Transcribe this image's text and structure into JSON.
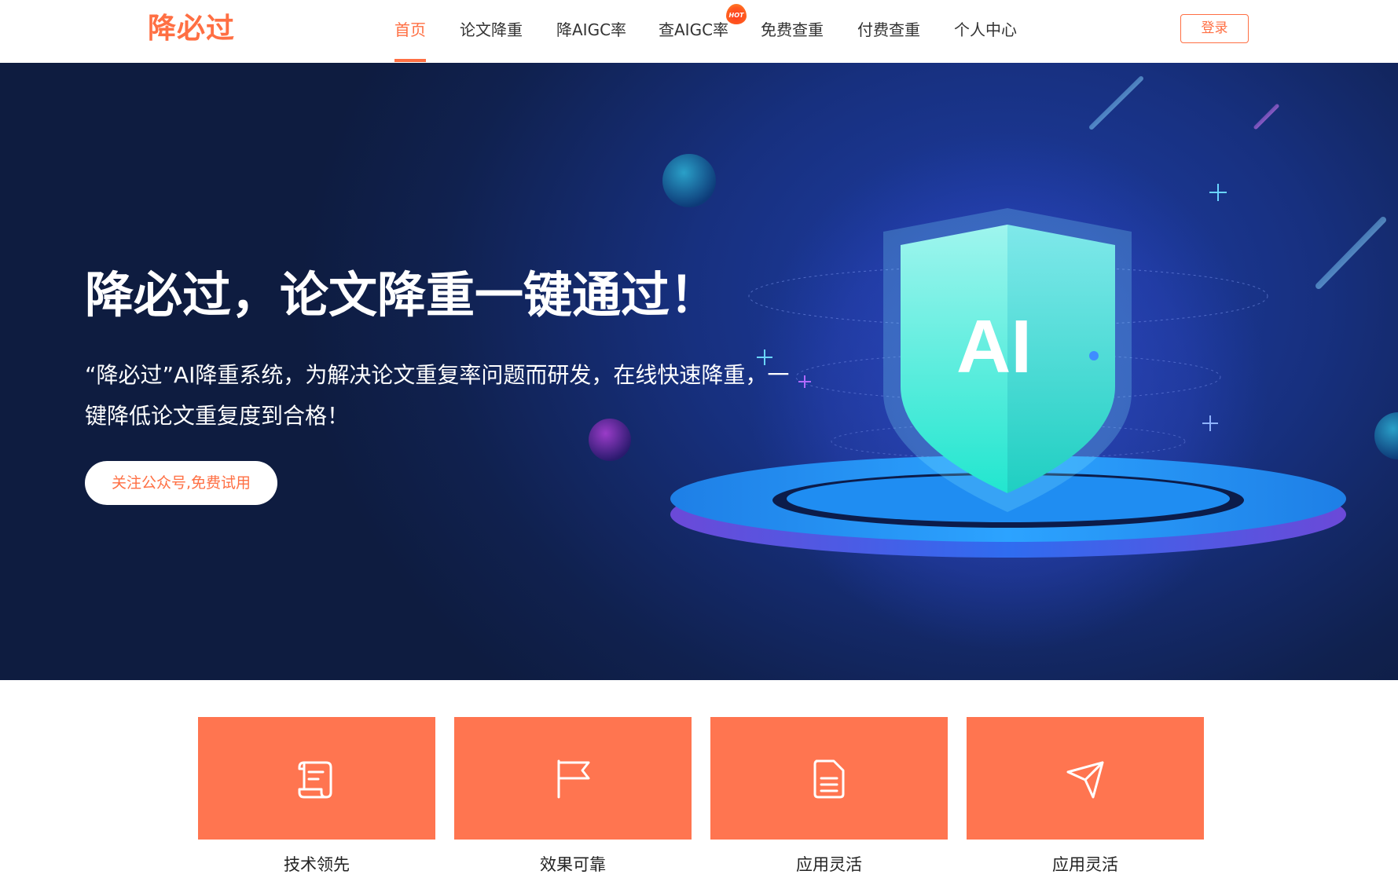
{
  "header": {
    "logo": "降必过",
    "nav": [
      {
        "label": "首页",
        "active": true
      },
      {
        "label": "论文降重",
        "active": false
      },
      {
        "label": "降AIGC率",
        "active": false
      },
      {
        "label": "查AIGC率",
        "active": false,
        "badge": "HOT"
      },
      {
        "label": "免费查重",
        "active": false
      },
      {
        "label": "付费查重",
        "active": false
      },
      {
        "label": "个人中心",
        "active": false
      }
    ],
    "login_label": "登录"
  },
  "hero": {
    "title": "降必过，论文降重一键通过！",
    "description": "“降必过”AI降重系统，为解决论文重复率问题而研发，在线快速降重，一键降低论文重复度到合格！",
    "cta_label": "关注公众号,免费试用",
    "shield_text": "AI"
  },
  "features": [
    {
      "label": "技术领先",
      "icon": "scroll-icon"
    },
    {
      "label": "效果可靠",
      "icon": "flag-icon"
    },
    {
      "label": "应用灵活",
      "icon": "document-icon"
    },
    {
      "label": "应用灵活",
      "icon": "send-icon"
    }
  ],
  "colors": {
    "accent": "#ff6f43",
    "feature_bg": "#ff7550",
    "hero_dark": "#0e1c40",
    "hero_blue": "#1f3ea8",
    "shield": "#3fe6d8"
  }
}
